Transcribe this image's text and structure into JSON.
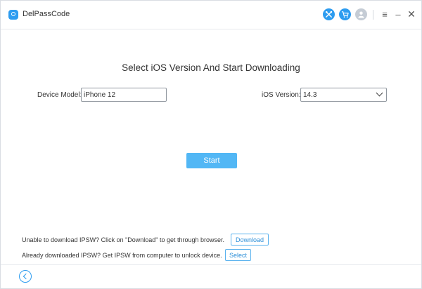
{
  "app": {
    "title": "DelPassCode",
    "icons": {
      "logo": "app-logo-icon",
      "tools": "tools-icon",
      "cart": "cart-icon",
      "user": "user-icon",
      "menu": "menu-icon",
      "minimize": "minimize-icon",
      "close": "close-icon"
    },
    "colors": {
      "accent": "#2d9cf0",
      "start_button": "#52b7f5",
      "user_icon": "#c5ccd5"
    }
  },
  "main": {
    "heading": "Select iOS Version And Start Downloading",
    "device_model_label": "Device Model:",
    "device_model_value": "iPhone 12",
    "ios_version_label": "iOS Version:",
    "ios_version_value": "14.3",
    "start_label": "Start"
  },
  "footer": {
    "download_hint": "Unable to download IPSW? Click on \"Download\" to get through browser.",
    "download_label": "Download",
    "select_hint": "Already downloaded IPSW? Get IPSW from computer to unlock device.",
    "select_label": "Select"
  }
}
